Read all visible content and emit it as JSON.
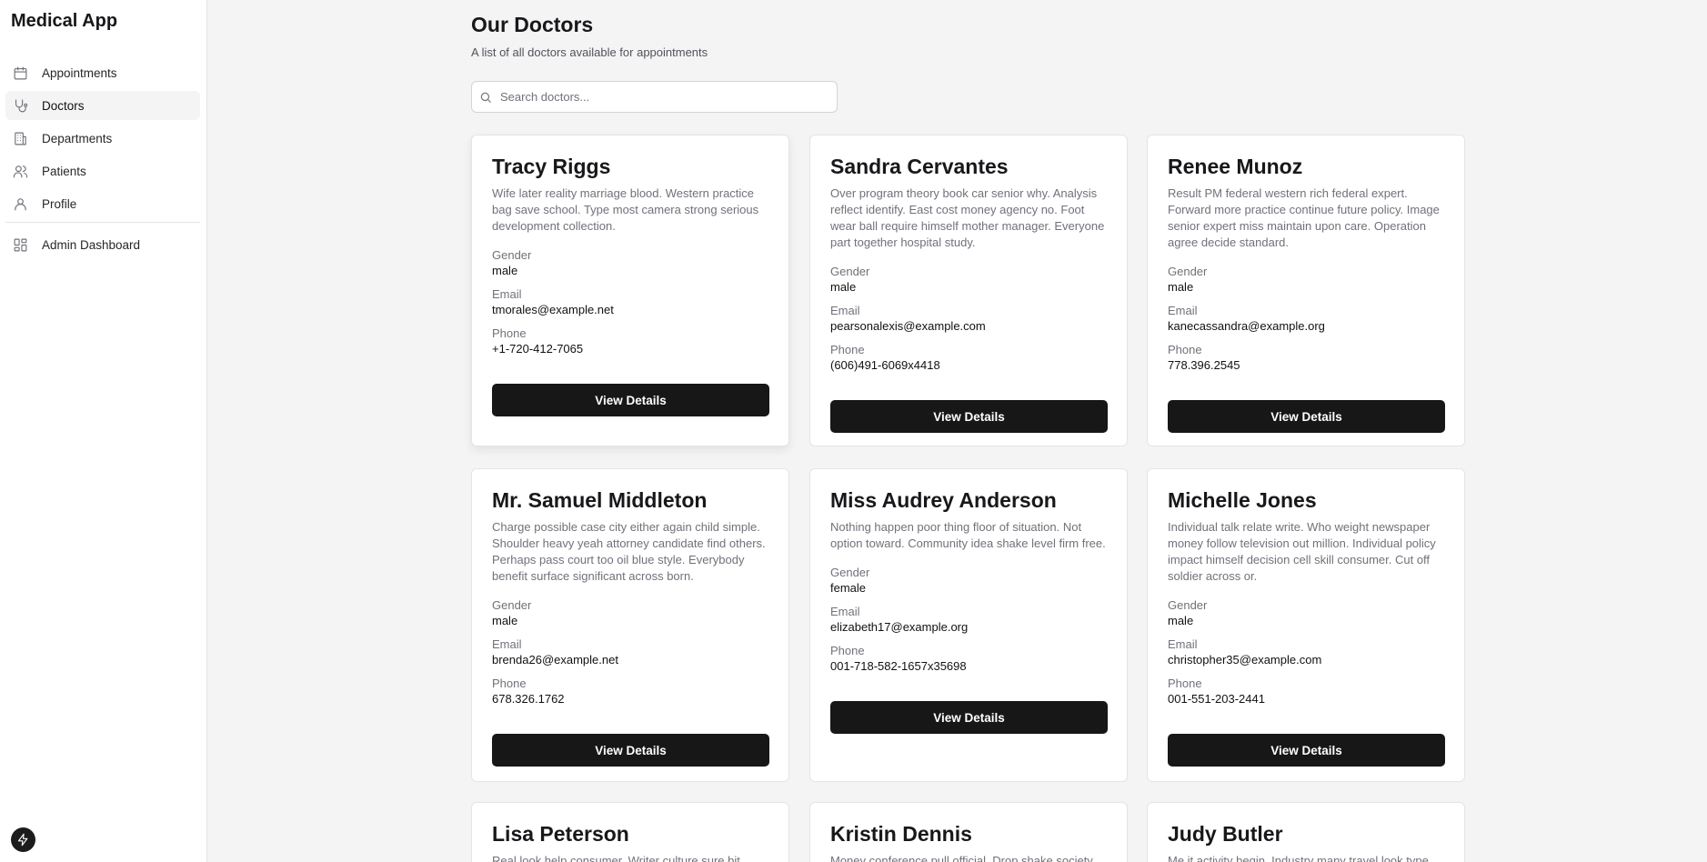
{
  "app": {
    "title": "Medical App"
  },
  "sidebar": {
    "items": [
      {
        "label": "Appointments",
        "icon": "calendar-icon",
        "active": false
      },
      {
        "label": "Doctors",
        "icon": "stethoscope-icon",
        "active": true
      },
      {
        "label": "Departments",
        "icon": "building-icon",
        "active": false
      },
      {
        "label": "Patients",
        "icon": "users-icon",
        "active": false
      },
      {
        "label": "Profile",
        "icon": "user-icon",
        "active": false
      }
    ],
    "admin": {
      "label": "Admin Dashboard",
      "icon": "dashboard-icon"
    }
  },
  "header": {
    "title": "Our Doctors",
    "subtitle": "A list of all doctors available for appointments"
  },
  "search": {
    "placeholder": "Search doctors...",
    "value": ""
  },
  "labels": {
    "gender": "Gender",
    "email": "Email",
    "phone": "Phone",
    "button": "View Details"
  },
  "doctors": [
    {
      "name": "Tracy Riggs",
      "description": "Wife later reality marriage blood. Western practice bag save school. Type most camera strong serious development collection.",
      "gender": "male",
      "email": "tmorales@example.net",
      "phone": "+1-720-412-7065"
    },
    {
      "name": "Sandra Cervantes",
      "description": "Over program theory book car senior why. Analysis reflect identify. East cost money agency no. Foot wear ball require himself mother manager. Everyone part together hospital study.",
      "gender": "male",
      "email": "pearsonalexis@example.com",
      "phone": "(606)491-6069x4418"
    },
    {
      "name": "Renee Munoz",
      "description": "Result PM federal western rich federal expert. Forward more practice continue future policy. Image senior expert miss maintain upon care. Operation agree decide standard.",
      "gender": "male",
      "email": "kanecassandra@example.org",
      "phone": "778.396.2545"
    },
    {
      "name": "Mr. Samuel Middleton",
      "description": "Charge possible case city either again child simple. Shoulder heavy yeah attorney candidate find others. Perhaps pass court too oil blue style. Everybody benefit surface significant across born.",
      "gender": "male",
      "email": "brenda26@example.net",
      "phone": "678.326.1762"
    },
    {
      "name": "Miss Audrey Anderson",
      "description": "Nothing happen poor thing floor of situation. Not option toward. Community idea shake level firm free.",
      "gender": "female",
      "email": "elizabeth17@example.org",
      "phone": "001-718-582-1657x35698"
    },
    {
      "name": "Michelle Jones",
      "description": "Individual talk relate write. Who weight newspaper money follow television out million. Individual policy impact himself decision cell skill consumer. Cut off soldier across or.",
      "gender": "male",
      "email": "christopher35@example.com",
      "phone": "001-551-203-2441"
    },
    {
      "name": "Lisa Peterson",
      "description": "Real look help consumer. Writer culture sure bit.",
      "gender": "",
      "email": "",
      "phone": ""
    },
    {
      "name": "Kristin Dennis",
      "description": "Money conference pull official. Drop shake society",
      "gender": "",
      "email": "",
      "phone": ""
    },
    {
      "name": "Judy Butler",
      "description": "Me it activity begin. Industry many travel look type.",
      "gender": "",
      "email": "",
      "phone": ""
    }
  ]
}
